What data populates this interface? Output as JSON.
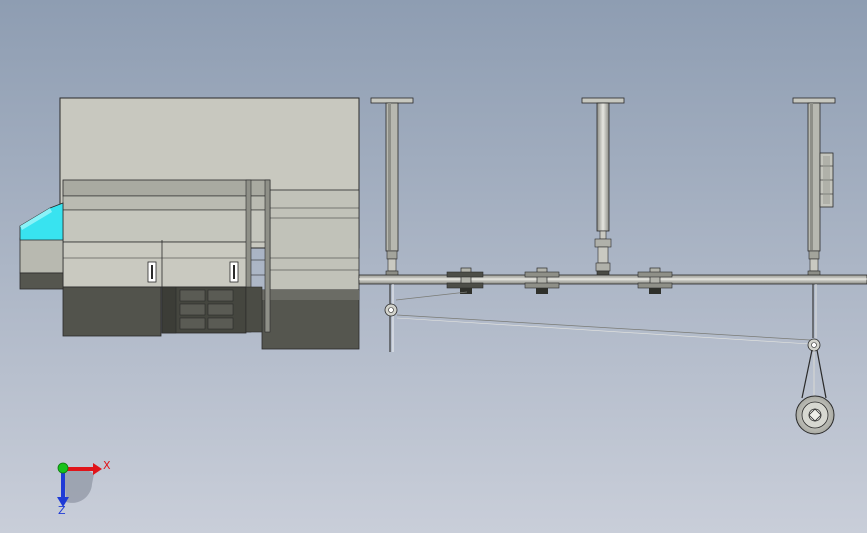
{
  "viewport": {
    "background_top": "#8e9db2",
    "background_bottom": "#c9ced9"
  },
  "colors": {
    "housing_light": "#c9c9c0",
    "housing_mid": "#b3b4ab",
    "housing_dark": "#55564f",
    "housing_darker": "#3f403b",
    "accent_cyan": "#38e3f0",
    "steel": "#b9bab4",
    "outline": "#2a2a2a",
    "axis_x": "#e0141a",
    "axis_y": "#18c21b",
    "axis_z": "#1f3bd6"
  },
  "triad": {
    "x_label": "X",
    "z_label": "Z"
  }
}
